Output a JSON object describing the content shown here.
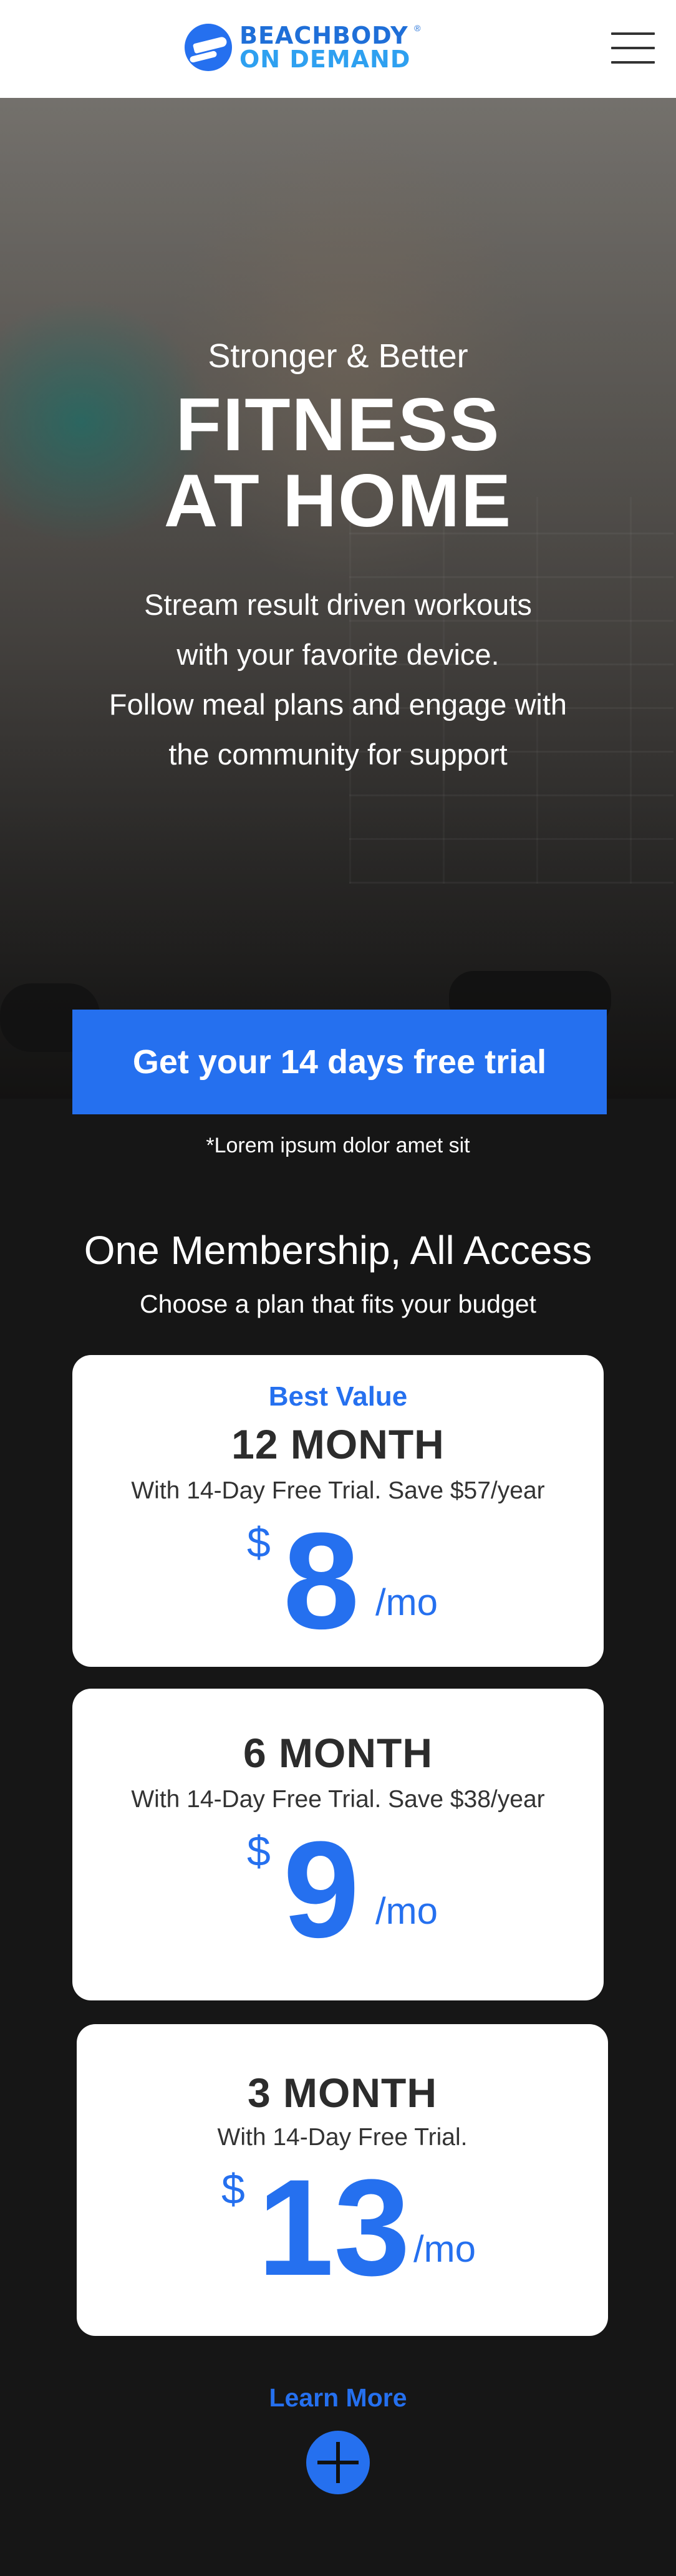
{
  "header": {
    "logo_line1": "BEACHBODY",
    "logo_line2": "ON DEMAND",
    "logo_reg": "®",
    "menu_icon": "hamburger-menu-icon"
  },
  "hero": {
    "eyebrow": "Stronger & Better",
    "title_line1": "FITNESS",
    "title_line2": "AT HOME",
    "desc_line1": "Stream result driven workouts",
    "desc_line2": "with your favorite device.",
    "desc_line3": "Follow meal plans and engage with",
    "desc_line4": "the community for support"
  },
  "cta": {
    "label": "Get your 14 days free trial"
  },
  "disclaimer": "*Lorem ipsum dolor amet sit",
  "membership": {
    "title": "One Membership, All Access",
    "subtitle": "Choose a plan that fits your budget"
  },
  "plans": [
    {
      "badge": "Best Value",
      "name": "12 MONTH",
      "sub": "With 14-Day Free Trial. Save $57/year",
      "currency": "$",
      "price": "8",
      "unit": "/mo"
    },
    {
      "name": "6 MONTH",
      "sub": "With 14-Day Free Trial. Save $38/year",
      "currency": "$",
      "price": "9",
      "unit": "/mo"
    },
    {
      "name": "3 MONTH",
      "sub": "With 14-Day Free Trial.",
      "currency": "$",
      "price": "13",
      "unit": "/mo"
    }
  ],
  "learn_more": {
    "label": "Learn More",
    "icon": "plus-icon"
  },
  "colors": {
    "accent": "#2570ef",
    "background": "#161616",
    "card": "#ffffff"
  }
}
